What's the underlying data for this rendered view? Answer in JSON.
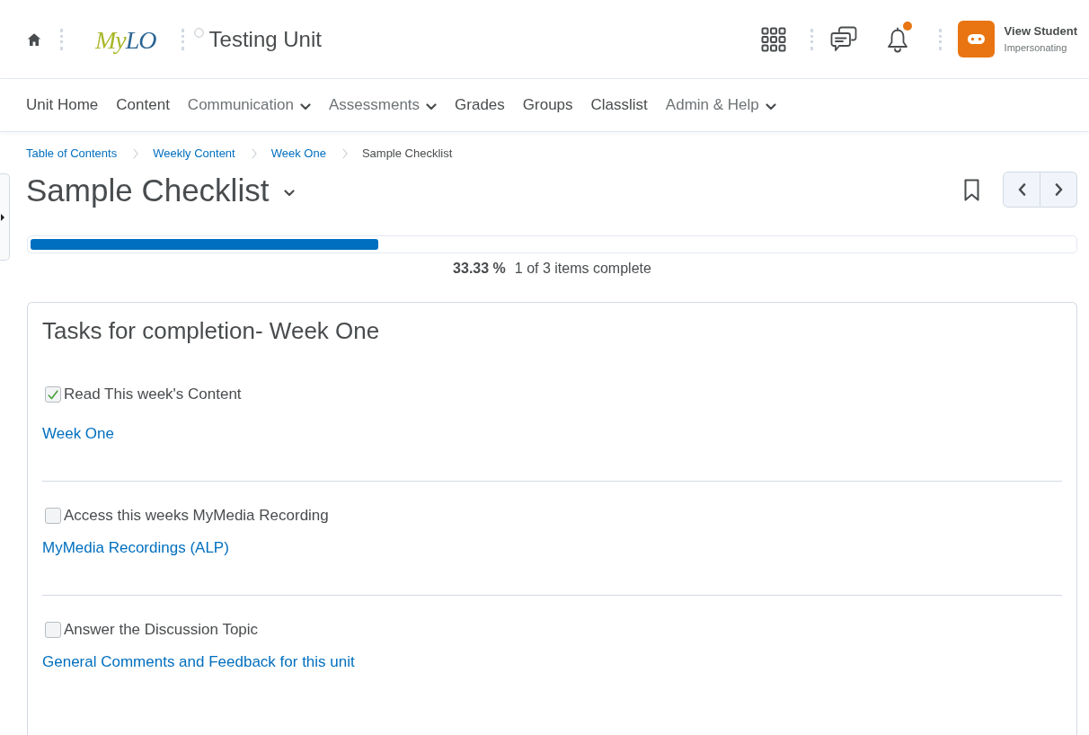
{
  "header": {
    "logo": [
      "My",
      "LO"
    ],
    "unit_title": "Testing Unit",
    "notifications_unread": true,
    "user": {
      "name": "View Student",
      "role": "Impersonating"
    }
  },
  "nav": [
    {
      "label": "Unit Home",
      "dropdown": false
    },
    {
      "label": "Content",
      "dropdown": false
    },
    {
      "label": "Communication",
      "dropdown": true
    },
    {
      "label": "Assessments",
      "dropdown": true
    },
    {
      "label": "Grades",
      "dropdown": false
    },
    {
      "label": "Groups",
      "dropdown": false
    },
    {
      "label": "Classlist",
      "dropdown": false
    },
    {
      "label": "Admin & Help",
      "dropdown": true
    }
  ],
  "breadcrumbs": [
    {
      "label": "Table of Contents",
      "kind": "link"
    },
    {
      "label": "Weekly Content",
      "kind": "link"
    },
    {
      "label": "Week One",
      "kind": "link"
    },
    {
      "label": "Sample Checklist",
      "kind": "current"
    }
  ],
  "page_title": "Sample Checklist",
  "progress": {
    "level": 0.3333,
    "percent": "33.33 %",
    "summary": "1 of 3 items complete"
  },
  "checklist": {
    "title": "Tasks for completion- Week One",
    "items": [
      {
        "label": "Read This week's Content",
        "checked": true,
        "link": "Week One"
      },
      {
        "label": "Access this weeks MyMedia Recording",
        "checked": false,
        "link": "MyMedia Recordings (ALP)"
      },
      {
        "label": "Answer the Discussion Topic",
        "checked": false,
        "link": "General Comments and Feedback for this unit"
      }
    ]
  }
}
